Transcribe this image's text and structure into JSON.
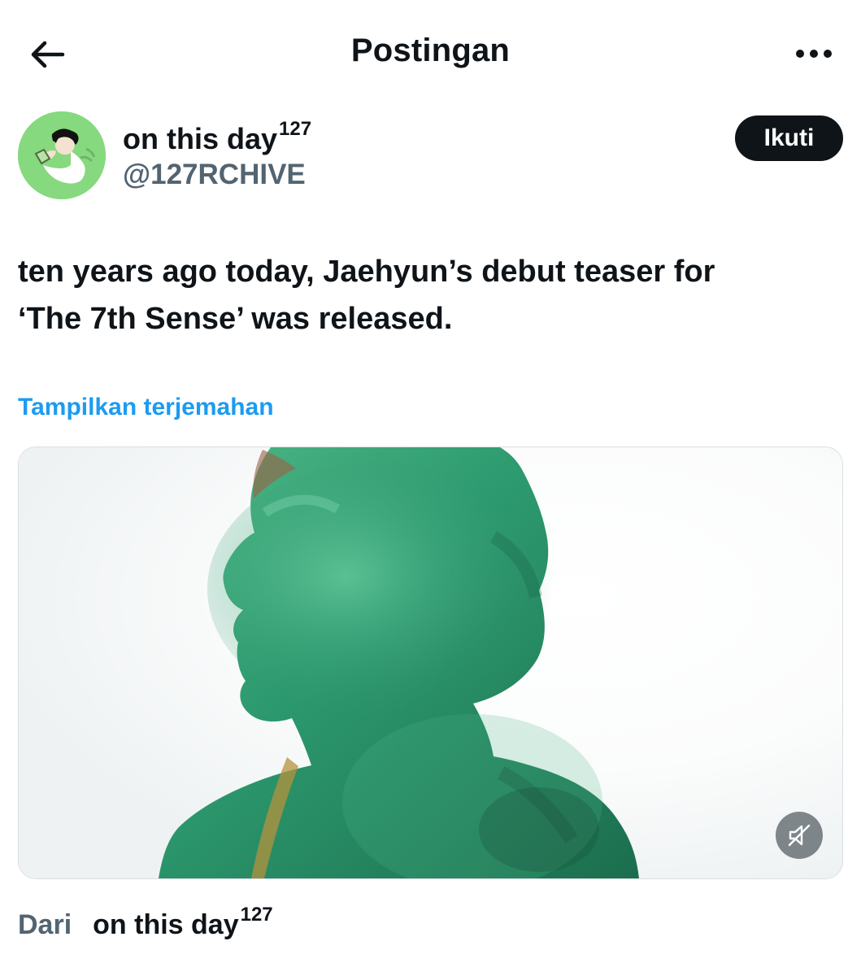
{
  "header": {
    "title": "Postingan",
    "back_icon": "arrow-left-icon",
    "more_icon": "more-horizontal-icon"
  },
  "author": {
    "name": "on this day",
    "name_superscript": "127",
    "handle": "@127RCHIVE",
    "follow_label": "Ikuti",
    "avatar_icon": "avatar-image"
  },
  "post": {
    "text": "ten years ago today, Jaehyun’s debut teaser for\n‘The 7th Sense’ was released.",
    "translate_label": "Tampilkan terjemahan"
  },
  "media": {
    "type": "video",
    "mute_icon": "muted-speaker-icon"
  },
  "source": {
    "label": "Dari",
    "name": "on this day",
    "name_superscript": "127"
  },
  "colors": {
    "link": "#1d9bf0",
    "secondary_text": "#536471",
    "primary_text": "#0f1419",
    "follow_button": "#0f1419",
    "avatar_bg": "#86d97e",
    "media_tint": "#2f9f73"
  }
}
